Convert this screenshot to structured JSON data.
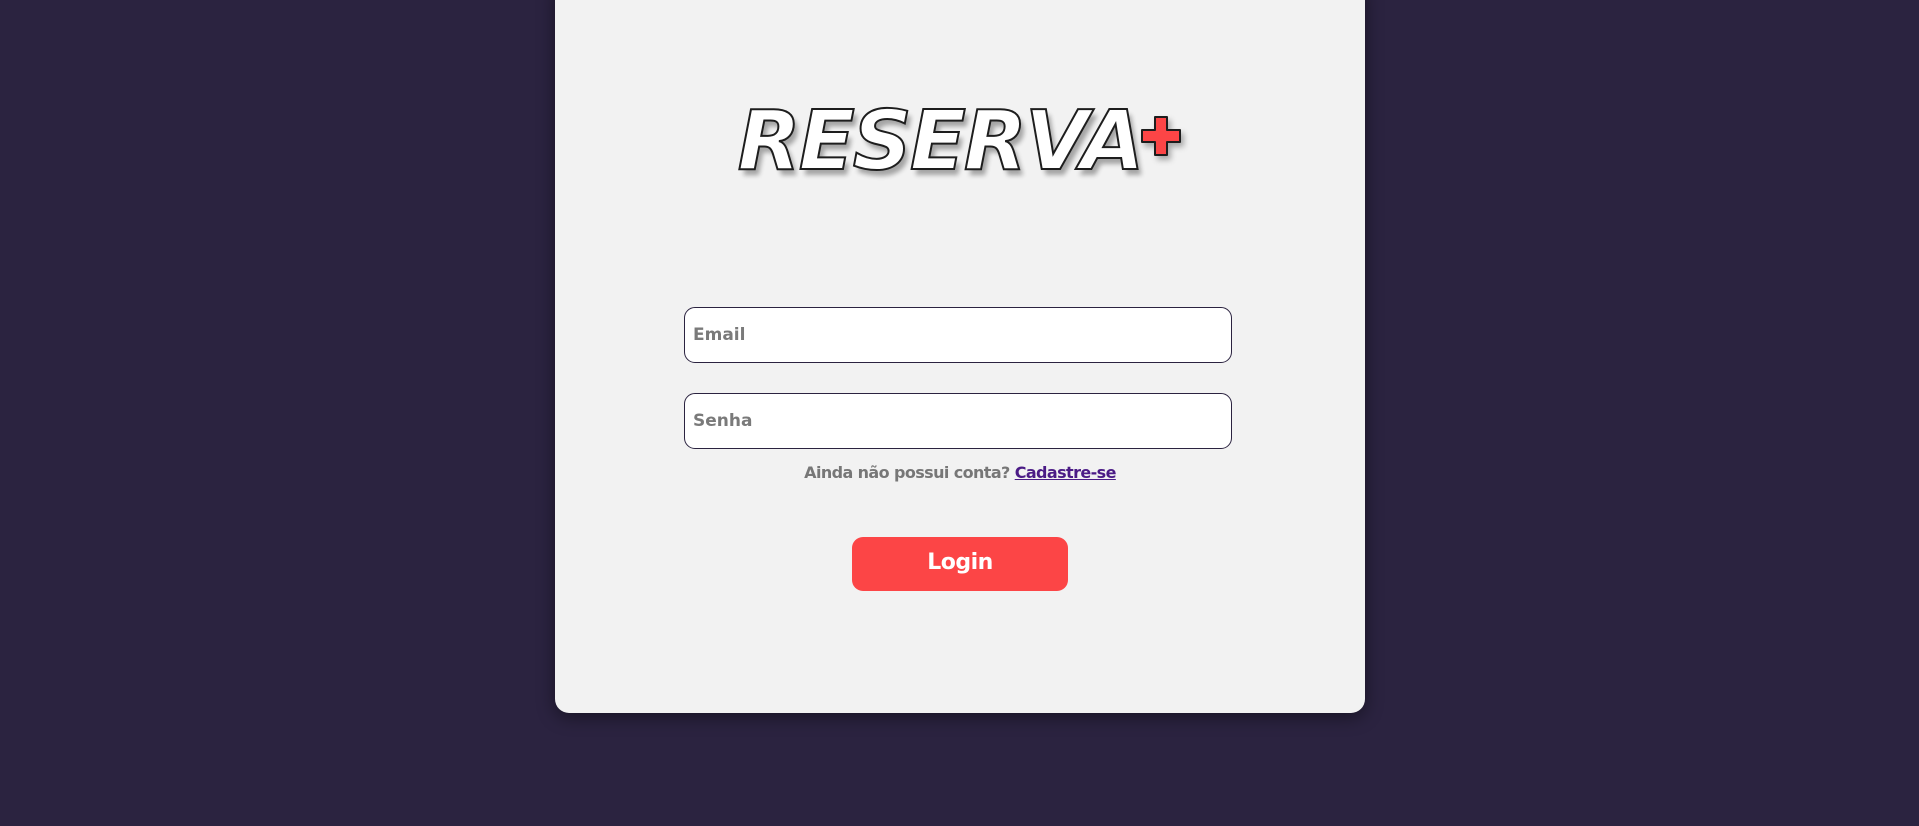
{
  "brand": {
    "logo_text": "RESERVA",
    "logo_suffix_icon": "plus-icon",
    "plus_color": "#fc4546"
  },
  "form": {
    "email_placeholder": "Email",
    "password_placeholder": "Senha",
    "signup_prompt": "Ainda não possui conta?",
    "signup_link": "Cadastre-se",
    "login_label": "Login"
  },
  "colors": {
    "background": "#2b2340",
    "card": "#f2f2f2",
    "accent": "#fc4546",
    "link": "#4b1b86"
  }
}
